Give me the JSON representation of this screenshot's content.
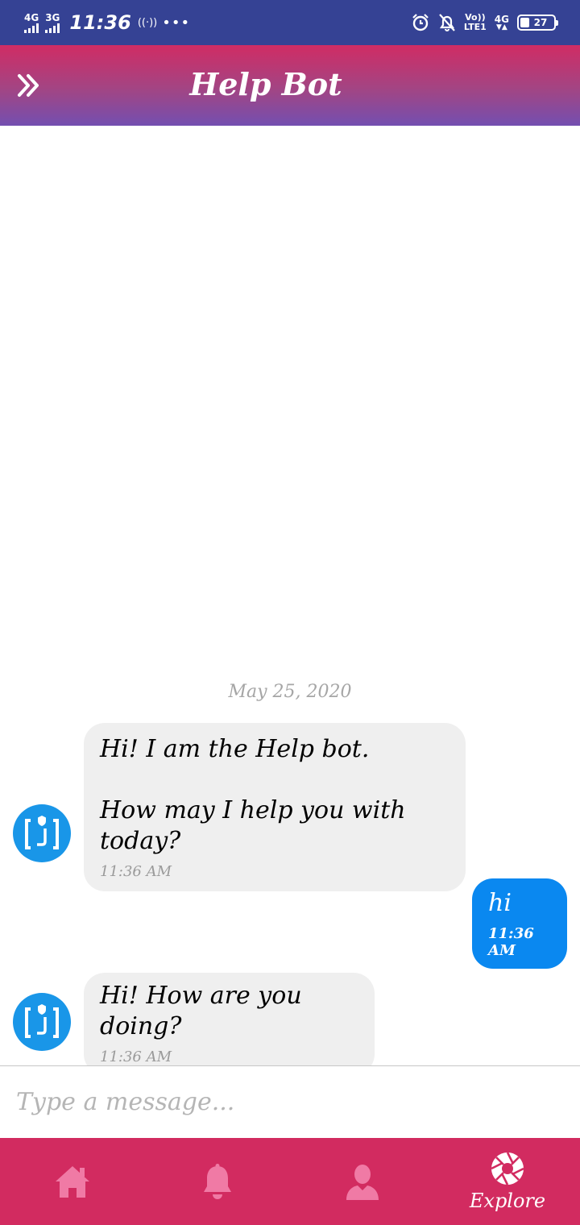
{
  "status_bar": {
    "sim1_network": "4G",
    "sim2_network": "3G",
    "time": "11:36",
    "hotspot": "((·))",
    "more": "•••",
    "volte_top": "Vo))",
    "volte_bottom": "LTE1",
    "data_network": "4G",
    "battery_percent": "27",
    "battery_level": 0.27
  },
  "header": {
    "title": "Help Bot",
    "menu_icon": "double-chevron-right-icon"
  },
  "chat": {
    "date_separator": "May 25, 2020",
    "messages": [
      {
        "sender": "bot",
        "text": "Hi! I am the Help bot.\n\nHow may I help you with today?",
        "time": "11:36 AM"
      },
      {
        "sender": "user",
        "text": "hi",
        "time": "11:36 AM"
      },
      {
        "sender": "bot",
        "text": "Hi! How are you doing?",
        "time": "11:36 AM"
      }
    ]
  },
  "composer": {
    "placeholder": "Type a message..."
  },
  "bottom_nav": {
    "items": [
      {
        "icon": "home-icon",
        "label": ""
      },
      {
        "icon": "bell-icon",
        "label": ""
      },
      {
        "icon": "user-icon",
        "label": ""
      },
      {
        "icon": "aperture-icon",
        "label": "Explore"
      }
    ]
  },
  "colors": {
    "status_bar": "#354294",
    "header_top": "#d02c64",
    "header_bottom": "#734fb0",
    "bot_bubble": "#efefef",
    "user_bubble": "#0a88f0",
    "avatar": "#1996e8",
    "bottom_nav": "#d22b60",
    "inactive_icon": "#f07aa5"
  }
}
